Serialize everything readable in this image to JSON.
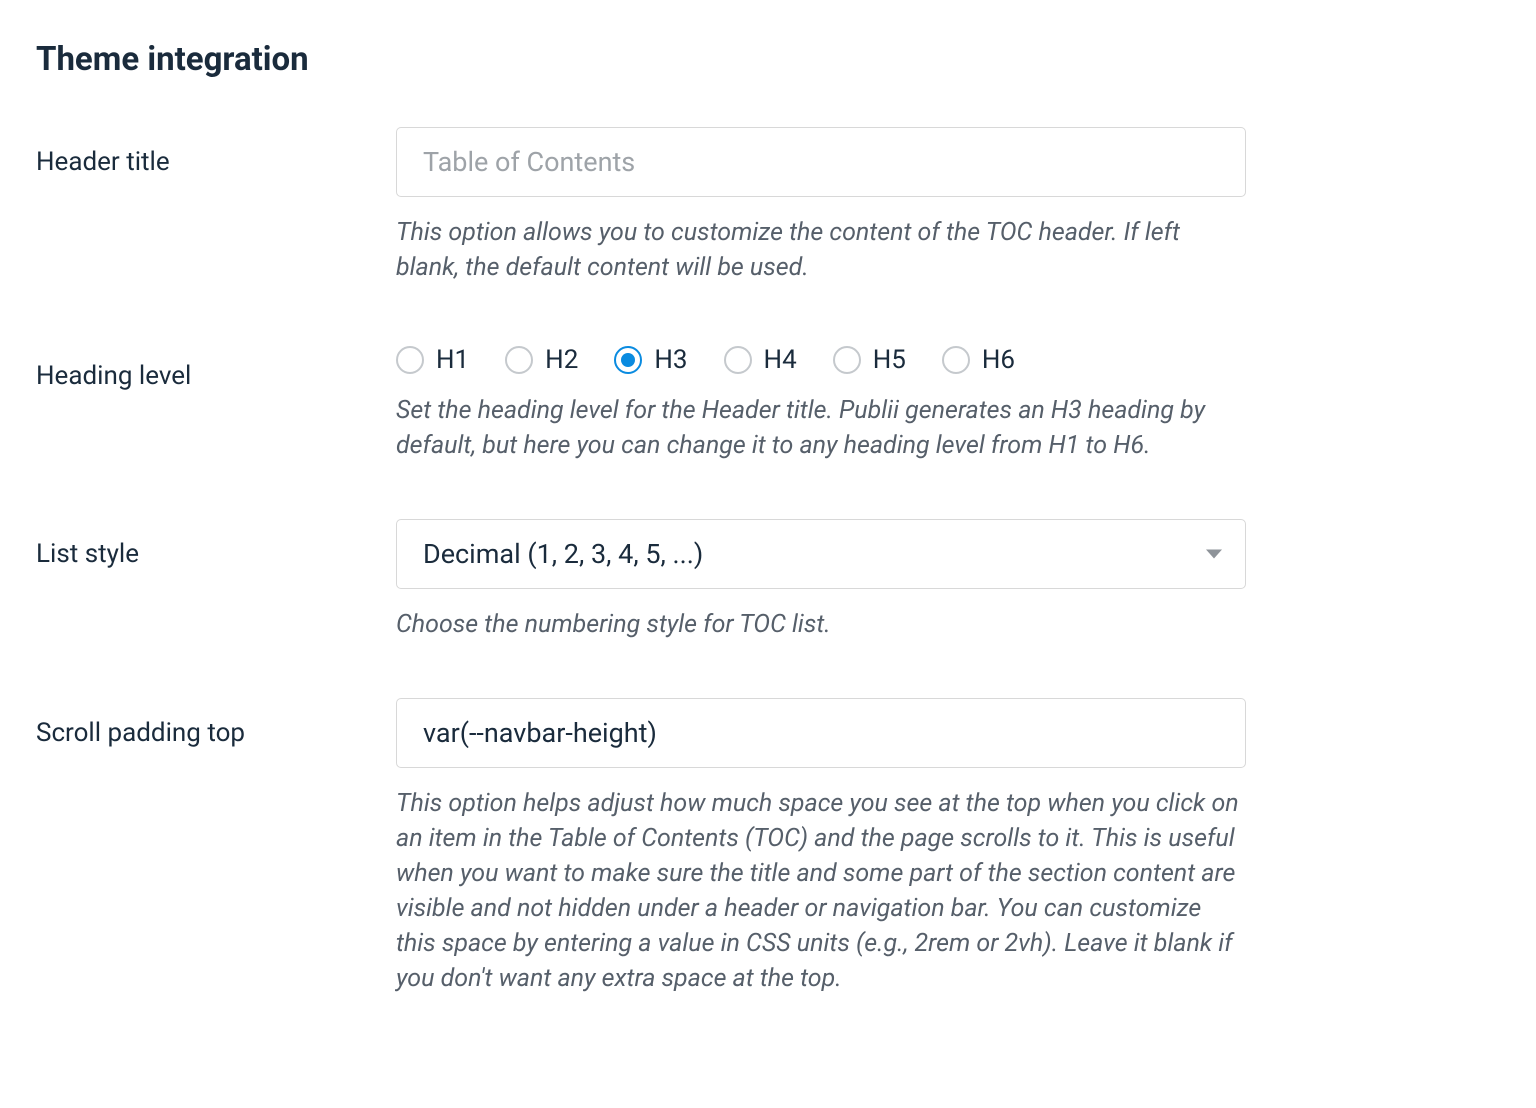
{
  "section_title": "Theme integration",
  "header_title": {
    "label": "Header title",
    "placeholder": "Table of Contents",
    "value": "",
    "help": "This option allows you to customize the content of the TOC header. If left blank, the default content will be used."
  },
  "heading_level": {
    "label": "Heading level",
    "options": [
      "H1",
      "H2",
      "H3",
      "H4",
      "H5",
      "H6"
    ],
    "selected": "H3",
    "help": "Set the heading level for the Header title. Publii generates an H3 heading by default, but here you can change it to any heading level from H1 to H6."
  },
  "list_style": {
    "label": "List style",
    "selected": "Decimal (1, 2, 3, 4, 5, ...)",
    "help": "Choose the numbering style for TOC list."
  },
  "scroll_padding_top": {
    "label": "Scroll padding top",
    "value": "var(--navbar-height)",
    "help": "This option helps adjust how much space you see at the top when you click on an item in the Table of Contents (TOC) and the page scrolls to it. This is useful when you want to make sure the title and some part of the section content are visible and not hidden under a header or navigation bar. You can customize this space by entering a value in CSS units (e.g., 2rem or 2vh). Leave it blank if you don't want any extra space at the top."
  }
}
